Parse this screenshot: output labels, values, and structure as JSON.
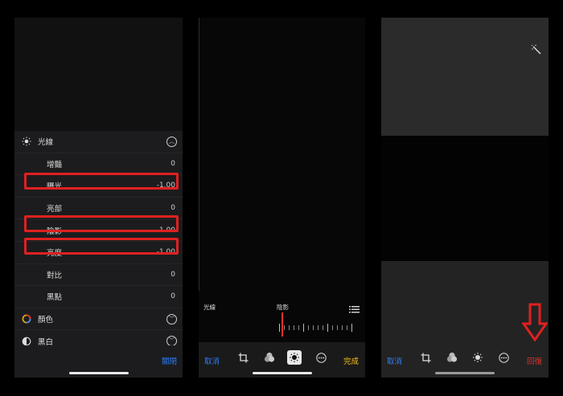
{
  "left_panel": {
    "light_section": {
      "title": "光線",
      "items": [
        {
          "label": "增豔",
          "value": "0"
        },
        {
          "label": "曝光",
          "value": "-1.00"
        },
        {
          "label": "亮部",
          "value": "0"
        },
        {
          "label": "陰影",
          "value": "-1.00"
        },
        {
          "label": "亮度",
          "value": "-1.00"
        },
        {
          "label": "對比",
          "value": "0"
        },
        {
          "label": "黑點",
          "value": "0"
        }
      ]
    },
    "color_section": {
      "title": "顏色"
    },
    "bw_section": {
      "title": "黑白"
    },
    "done_label": "關閉",
    "highlighted_items": [
      "曝光",
      "陰影",
      "亮度"
    ]
  },
  "middle_panel": {
    "slider_left_label": "光線",
    "slider_center_label": "陰影",
    "cancel_label": "取消",
    "done_label": "完成"
  },
  "right_panel": {
    "cancel_label": "取消",
    "revert_label": "回復"
  },
  "colors": {
    "accent_blue": "#2f7cf6",
    "done_yellow": "#f5c518",
    "revert_red": "#e0322b",
    "highlight_red": "#e02020"
  }
}
